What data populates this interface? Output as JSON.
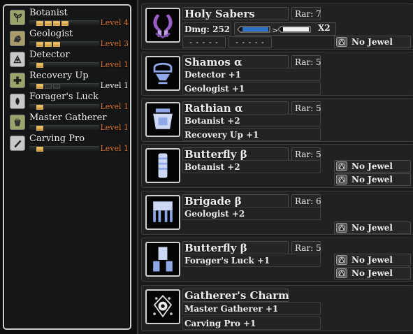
{
  "skills": [
    {
      "name": "Botanist",
      "level": "Level 4",
      "pips_on": 4,
      "pips_total": 4,
      "max": false,
      "icon": "plant-skill-icon",
      "icon_color": "#9aa36a"
    },
    {
      "name": "Geologist",
      "level": "Level 3",
      "pips_on": 3,
      "pips_total": 3,
      "max": false,
      "icon": "ore-skill-icon",
      "icon_color": "#a89d6a"
    },
    {
      "name": "Detector",
      "level": "Level 1",
      "pips_on": 1,
      "pips_total": 1,
      "max": false,
      "icon": "detector-skill-icon",
      "icon_color": "#c8c8c8"
    },
    {
      "name": "Recovery Up",
      "level": "Level 1",
      "pips_on": 1,
      "pips_total": 3,
      "max": true,
      "icon": "recovery-skill-icon",
      "icon_color": "#9aa36a"
    },
    {
      "name": "Forager's Luck",
      "level": "Level 1",
      "pips_on": 1,
      "pips_total": 1,
      "max": false,
      "icon": "forager-skill-icon",
      "icon_color": "#c8c8c8"
    },
    {
      "name": "Master Gatherer",
      "level": "Level 1",
      "pips_on": 1,
      "pips_total": 1,
      "max": false,
      "icon": "gatherer-skill-icon",
      "icon_color": "#9aa36a"
    },
    {
      "name": "Carving Pro",
      "level": "Level 1",
      "pips_on": 1,
      "pips_total": 1,
      "max": false,
      "icon": "carving-skill-icon",
      "icon_color": "#c8c8c8"
    }
  ],
  "weapon": {
    "name": "Holy Sabers",
    "rarity": "Rar: 7",
    "damage": "Dmg: 252",
    "sharpness_mult": "X2",
    "slot1": "- - - - -",
    "slot2": "- - - - -",
    "jewel": "No Jewel",
    "icon": "dual-blades-icon"
  },
  "armor": [
    {
      "name": "Shamos α",
      "rarity": "Rar: 5",
      "skills": [
        "Detector +1",
        "Geologist +1"
      ],
      "jewels": [],
      "icon": "helm-icon"
    },
    {
      "name": "Rathian α",
      "rarity": "Rar: 5",
      "skills": [
        "Botanist +2",
        "Recovery Up +1"
      ],
      "jewels": [],
      "icon": "chest-icon"
    },
    {
      "name": "Butterfly β",
      "rarity": "Rar: 5",
      "skills": [
        "Botanist +2"
      ],
      "jewels": [
        "No Jewel",
        "No Jewel"
      ],
      "icon": "arm-icon"
    },
    {
      "name": "Brigade β",
      "rarity": "Rar: 6",
      "skills": [
        "Geologist +2"
      ],
      "jewels": [
        "No Jewel"
      ],
      "icon": "waist-icon"
    },
    {
      "name": "Butterfly β",
      "rarity": "Rar: 5",
      "skills": [
        "Forager's Luck +1"
      ],
      "jewels": [
        "No Jewel",
        "No Jewel"
      ],
      "icon": "legs-icon"
    }
  ],
  "charm": {
    "name": "Gatherer's Charm",
    "skills": [
      "Master Gatherer +1",
      "Carving Pro +1"
    ],
    "icon": "charm-icon"
  },
  "colors": {
    "level_text": "#e0732c",
    "pip_on": "#e0b35c",
    "weapon_purple": "#9a5fc8",
    "armor_blue": "#8fa9e8",
    "sharp_blue": "#2f73c9"
  }
}
